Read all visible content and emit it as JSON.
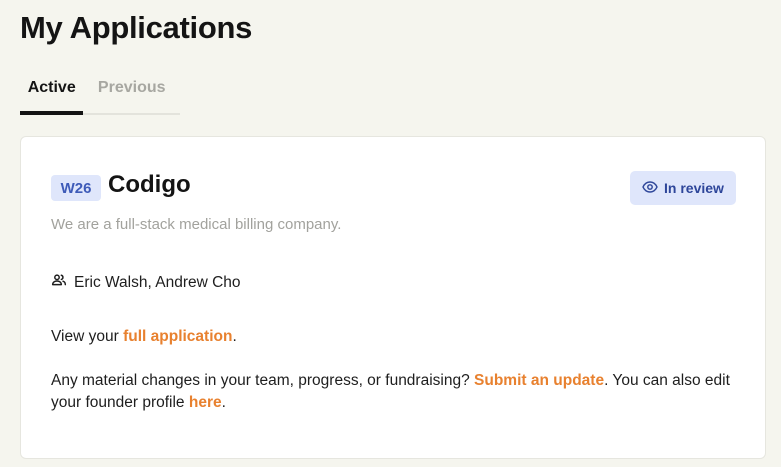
{
  "header": {
    "title": "My Applications"
  },
  "tabs": [
    {
      "label": "Active",
      "active": true
    },
    {
      "label": "Previous",
      "active": false
    }
  ],
  "application": {
    "batch": "W26",
    "company": "Codigo",
    "status": {
      "label": "In review",
      "icon": "eye-icon"
    },
    "description": "We are a full-stack medical billing company.",
    "founders": {
      "icon": "people-icon",
      "names": "Eric Walsh, Andrew Cho"
    },
    "view_line": {
      "prefix": "View your ",
      "link": "full application",
      "suffix": "."
    },
    "update_line": {
      "prefix": "Any material changes in your team, progress, or fundraising? ",
      "link1": "Submit an update",
      "middle": ". You can also edit your founder profile ",
      "link2": "here",
      "suffix": "."
    }
  },
  "colors": {
    "background": "#f5f5ee",
    "accent_link": "#e8812f",
    "badge_bg": "#dfe6fb",
    "badge_text": "#3e5bb8"
  }
}
